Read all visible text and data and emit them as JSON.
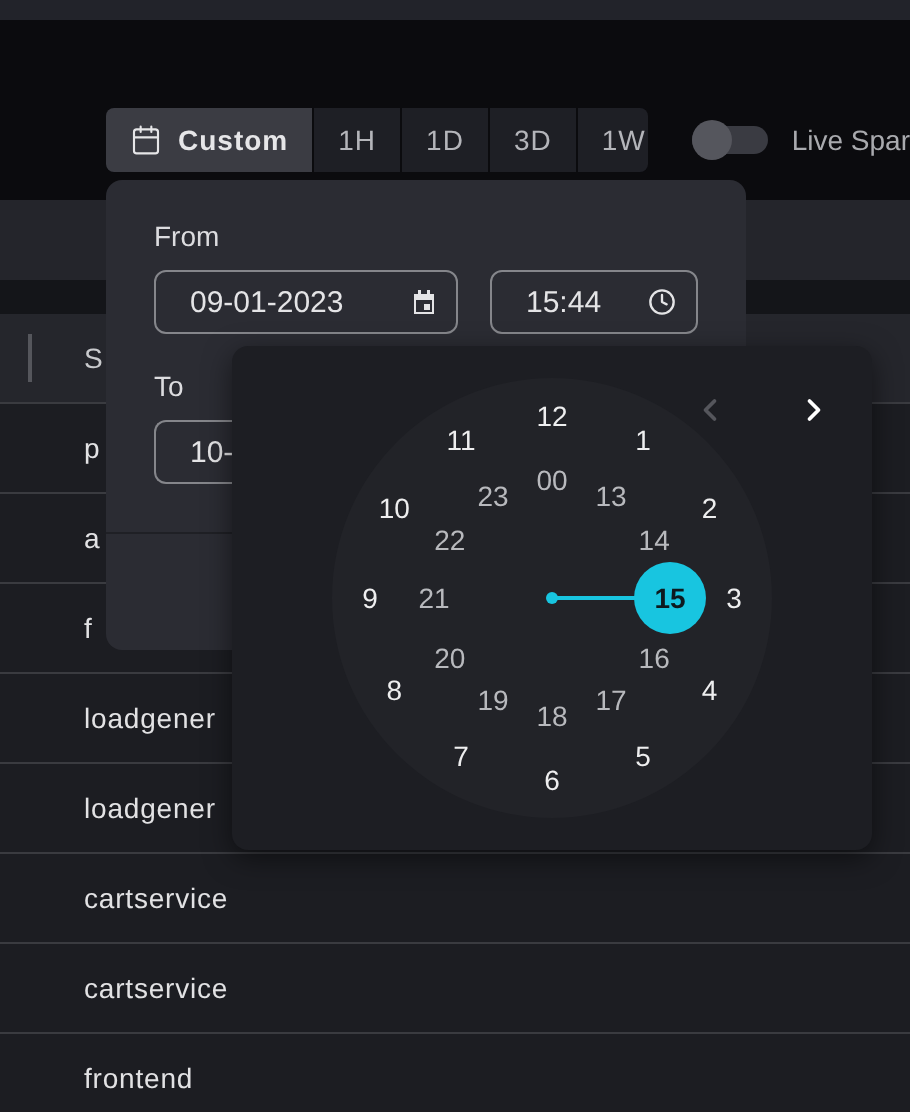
{
  "toolbar": {
    "ranges": [
      {
        "kind": "custom",
        "label": "Custom",
        "selected": true
      },
      {
        "kind": "preset",
        "label": "1H",
        "selected": false
      },
      {
        "kind": "preset",
        "label": "1D",
        "selected": false
      },
      {
        "kind": "preset",
        "label": "3D",
        "selected": false
      },
      {
        "kind": "preset",
        "label": "1W",
        "selected": false
      }
    ],
    "live_toggle": {
      "label": "Live Spar",
      "on": false
    }
  },
  "table": {
    "header": "S",
    "rows": [
      "p",
      "a",
      "f",
      "loadgener",
      "loadgener",
      "cartservice",
      "cartservice",
      "frontend"
    ]
  },
  "range_popover": {
    "from_label": "From",
    "from_date": "09-01-2023",
    "from_time": "15:44",
    "to_label": "To",
    "to_date": "10-"
  },
  "clock": {
    "nav": [
      {
        "kind": "prev",
        "disabled": true
      },
      {
        "kind": "next",
        "disabled": false
      }
    ],
    "outer": [
      {
        "label": "12",
        "selected": false
      },
      {
        "label": "1",
        "selected": false
      },
      {
        "label": "2",
        "selected": false
      },
      {
        "label": "3",
        "selected": false
      },
      {
        "label": "4",
        "selected": false
      },
      {
        "label": "5",
        "selected": false
      },
      {
        "label": "6",
        "selected": false
      },
      {
        "label": "7",
        "selected": false
      },
      {
        "label": "8",
        "selected": false
      },
      {
        "label": "9",
        "selected": false
      },
      {
        "label": "10",
        "selected": false
      },
      {
        "label": "11",
        "selected": false
      }
    ],
    "inner": [
      {
        "label": "00",
        "selected": false
      },
      {
        "label": "13",
        "selected": false
      },
      {
        "label": "14",
        "selected": false
      },
      {
        "label": "15",
        "selected": true
      },
      {
        "label": "16",
        "selected": false
      },
      {
        "label": "17",
        "selected": false
      },
      {
        "label": "18",
        "selected": false
      },
      {
        "label": "19",
        "selected": false
      },
      {
        "label": "20",
        "selected": false
      },
      {
        "label": "21",
        "selected": false
      },
      {
        "label": "22",
        "selected": false
      },
      {
        "label": "23",
        "selected": false
      }
    ]
  }
}
